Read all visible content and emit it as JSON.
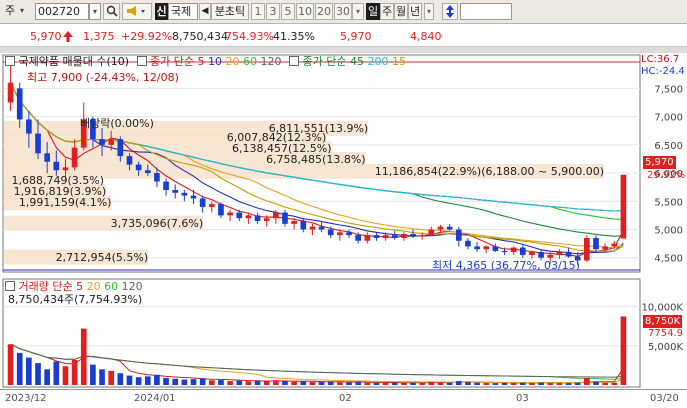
{
  "toolbar": {
    "market": "주",
    "code": "002720",
    "search_icon": "magnifier-icon",
    "speaker_icon": "speaker-icon",
    "badge": "신",
    "stock_name": "국제",
    "prev_arrow": "◀",
    "unit_label": "분초틱",
    "intervals": [
      "1",
      "3",
      "5",
      "10",
      "20",
      "30"
    ],
    "dropdown_arrow": "▾",
    "periods": [
      "일",
      "주",
      "월",
      "년"
    ],
    "active_period": "일",
    "toggle_icon": "up-down-arrow-icon"
  },
  "quote": {
    "price": "5,970",
    "change": "1,375",
    "change_pct": "+29.92%",
    "volume": "8,750,434",
    "volume_ratio": "754.93%",
    "turnover": "41.35%",
    "high": "5,970",
    "low": "4,840",
    "colors": {
      "up": "#e02020",
      "down": "#1a3fd0"
    }
  },
  "price_panel": {
    "legend_name": "국제약품 매물대 수(10)",
    "legend_ma_title": "종가 단순",
    "ma_periods": [
      "5",
      "10",
      "20",
      "60",
      "120"
    ],
    "ma_colors": [
      "#d01b1b",
      "#2a2ab8",
      "#e8a020",
      "#30c030",
      "#606060"
    ],
    "legend_ma2_title": "종가 단순",
    "ma2_periods": [
      "45",
      "200",
      "15"
    ],
    "ma2_colors": [
      "#1a8a3a",
      "#20c0e0",
      "#c0a000"
    ],
    "high_label": "최고 7,900 (-24.43%, 12/08)",
    "low_label": "최저 4,365 (36.77%, 03/15)",
    "dividend_label": "배당락(0.00%)",
    "lc_label": "LC:36.7",
    "hc_label": "HC:-24.4",
    "current_tag": "5,970",
    "current_pct": "29.92%",
    "y_ticks": [
      "7,500",
      "7,000",
      "6,500",
      "6,000",
      "5,500",
      "5,000",
      "4,500"
    ],
    "volume_profile": [
      {
        "label": "6,811,551(13.9%)",
        "price": 6800
      },
      {
        "label": "6,007,842(12.3%)",
        "price": 6630
      },
      {
        "label": "6,138,457(12.5%)",
        "price": 6450
      },
      {
        "label": "6,758,485(13.8%)",
        "price": 6250
      },
      {
        "label": "11,186,854(22.9%)(6,188.00 ~ 5,900.00)",
        "price": 6040
      },
      {
        "label": "1,688,749(3.5%)",
        "price": 5870
      },
      {
        "label": "1,916,819(3.9%)",
        "price": 5680
      },
      {
        "label": "1,991,159(4.1%)",
        "price": 5480
      },
      {
        "label": "3,735,096(7.6%)",
        "price": 5120
      },
      {
        "label": "2,712,954(5.5%)",
        "price": 4520
      }
    ]
  },
  "volume_panel": {
    "legend_title": "거래량 단순",
    "ma_periods": [
      "5",
      "20",
      "60",
      "120"
    ],
    "ma_colors": [
      "#d01b1b",
      "#e8a020",
      "#30c030",
      "#606060"
    ],
    "value_label": "8,750,434주(7,754.93%)",
    "y_ticks": [
      "10,000K",
      "5,000K"
    ],
    "current_tag": "8,750K",
    "current_pct": "7754.9"
  },
  "x_axis": {
    "labels": [
      "2023/12",
      "2024/01",
      "02",
      "03",
      "03/20"
    ]
  },
  "chart_data": {
    "type": "candlestick",
    "price_range": [
      4300,
      7950
    ],
    "volume_range": [
      0,
      12000000
    ],
    "candles": [
      [
        7250,
        7900,
        7100,
        7600
      ],
      [
        7500,
        7600,
        6800,
        6950
      ],
      [
        6950,
        7100,
        6450,
        6700
      ],
      [
        6700,
        6950,
        6250,
        6350
      ],
      [
        6350,
        6550,
        6000,
        6200
      ],
      [
        6200,
        6400,
        5950,
        6050
      ],
      [
        6050,
        6250,
        5900,
        6100
      ],
      [
        6100,
        6600,
        6050,
        6450
      ],
      [
        6450,
        7250,
        6400,
        6950
      ],
      [
        6950,
        7000,
        6450,
        6600
      ],
      [
        6600,
        6800,
        6300,
        6500
      ],
      [
        6500,
        6750,
        6400,
        6600
      ],
      [
        6600,
        6650,
        6200,
        6300
      ],
      [
        6300,
        6350,
        6050,
        6150
      ],
      [
        6150,
        6200,
        5950,
        6050
      ],
      [
        6050,
        6150,
        5950,
        6000
      ],
      [
        6000,
        6100,
        5750,
        5850
      ],
      [
        5850,
        5900,
        5600,
        5700
      ],
      [
        5700,
        5800,
        5550,
        5650
      ],
      [
        5650,
        5700,
        5500,
        5600
      ],
      [
        5600,
        5700,
        5450,
        5550
      ],
      [
        5550,
        5600,
        5300,
        5400
      ],
      [
        5400,
        5500,
        5300,
        5450
      ],
      [
        5450,
        5480,
        5200,
        5250
      ],
      [
        5250,
        5350,
        5150,
        5300
      ],
      [
        5300,
        5350,
        5150,
        5200
      ],
      [
        5200,
        5300,
        5100,
        5250
      ],
      [
        5250,
        5300,
        5100,
        5150
      ],
      [
        5150,
        5250,
        5050,
        5200
      ],
      [
        5200,
        5350,
        5100,
        5300
      ],
      [
        5300,
        5350,
        5050,
        5100
      ],
      [
        5100,
        5200,
        5000,
        5150
      ],
      [
        5150,
        5200,
        4950,
        5000
      ],
      [
        5000,
        5100,
        4900,
        5050
      ],
      [
        5050,
        5150,
        4950,
        5000
      ],
      [
        5000,
        5050,
        4850,
        4900
      ],
      [
        4900,
        5000,
        4800,
        4950
      ],
      [
        4950,
        5000,
        4850,
        4900
      ],
      [
        4900,
        4950,
        4750,
        4800
      ],
      [
        4800,
        4950,
        4750,
        4900
      ],
      [
        4900,
        4950,
        4800,
        4850
      ],
      [
        4850,
        4950,
        4800,
        4900
      ],
      [
        4900,
        4980,
        4820,
        4850
      ],
      [
        4850,
        4950,
        4800,
        4920
      ],
      [
        4920,
        5000,
        4850,
        4880
      ],
      [
        4880,
        4950,
        4820,
        4900
      ],
      [
        4900,
        5050,
        4880,
        5000
      ],
      [
        5000,
        5080,
        4950,
        5050
      ],
      [
        5050,
        5100,
        4980,
        5000
      ],
      [
        5000,
        5050,
        4700,
        4800
      ],
      [
        4800,
        4850,
        4650,
        4700
      ],
      [
        4700,
        4780,
        4600,
        4650
      ],
      [
        4650,
        4720,
        4580,
        4700
      ],
      [
        4700,
        4750,
        4600,
        4620
      ],
      [
        4620,
        4680,
        4550,
        4600
      ],
      [
        4600,
        4700,
        4550,
        4680
      ],
      [
        4680,
        4720,
        4500,
        4550
      ],
      [
        4550,
        4620,
        4480,
        4600
      ],
      [
        4600,
        4650,
        4450,
        4500
      ],
      [
        4500,
        4600,
        4400,
        4550
      ],
      [
        4550,
        4650,
        4480,
        4600
      ],
      [
        4600,
        4680,
        4500,
        4520
      ],
      [
        4520,
        4600,
        4365,
        4450
      ],
      [
        4450,
        4900,
        4420,
        4850
      ],
      [
        4850,
        4900,
        4600,
        4650
      ],
      [
        4650,
        4750,
        4600,
        4700
      ],
      [
        4700,
        4800,
        4650,
        4750
      ],
      [
        4840,
        5970,
        4840,
        5970
      ]
    ],
    "volumes": [
      5200000,
      4100000,
      3500000,
      2800000,
      2000000,
      3000000,
      2400000,
      3200000,
      7200000,
      2600000,
      2000000,
      1800000,
      1500000,
      1200000,
      1000000,
      1100000,
      1300000,
      900000,
      800000,
      700000,
      750000,
      850000,
      600000,
      650000,
      500000,
      550000,
      480000,
      520000,
      450000,
      600000,
      500000,
      420000,
      460000,
      380000,
      400000,
      450000,
      350000,
      330000,
      420000,
      300000,
      280000,
      320000,
      300000,
      260000,
      280000,
      300000,
      420000,
      350000,
      320000,
      500000,
      380000,
      300000,
      260000,
      240000,
      280000,
      250000,
      300000,
      260000,
      320000,
      280000,
      260000,
      240000,
      300000,
      900000,
      420000,
      300000,
      280000,
      8750434
    ]
  }
}
